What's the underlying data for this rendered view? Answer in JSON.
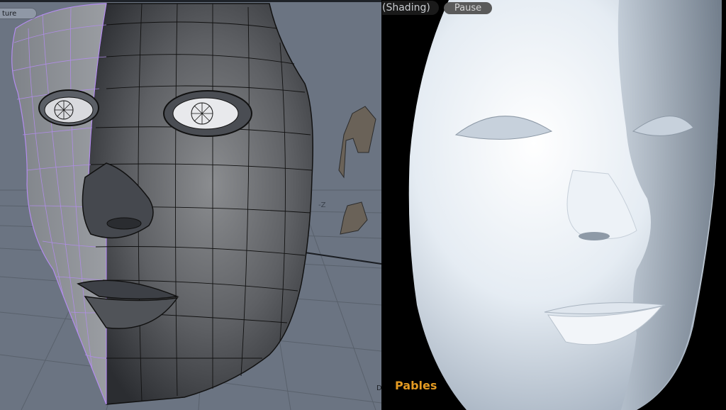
{
  "left_viewport": {
    "texture_tab_label": "ture",
    "axis_label": "-Z",
    "corner_label": "D"
  },
  "right_viewport": {
    "shading_label": "(Shading)",
    "pause_label": "Pause",
    "signature": "Pables"
  },
  "colors": {
    "viewport_bg": "#6b7482",
    "render_bg": "#000000",
    "mesh_wire": "#111111",
    "selection_wire": "#b48cf0",
    "signature": "#e39a22"
  },
  "icons": {
    "eye": "wireframe-eye",
    "deformer": "bone-handle"
  }
}
